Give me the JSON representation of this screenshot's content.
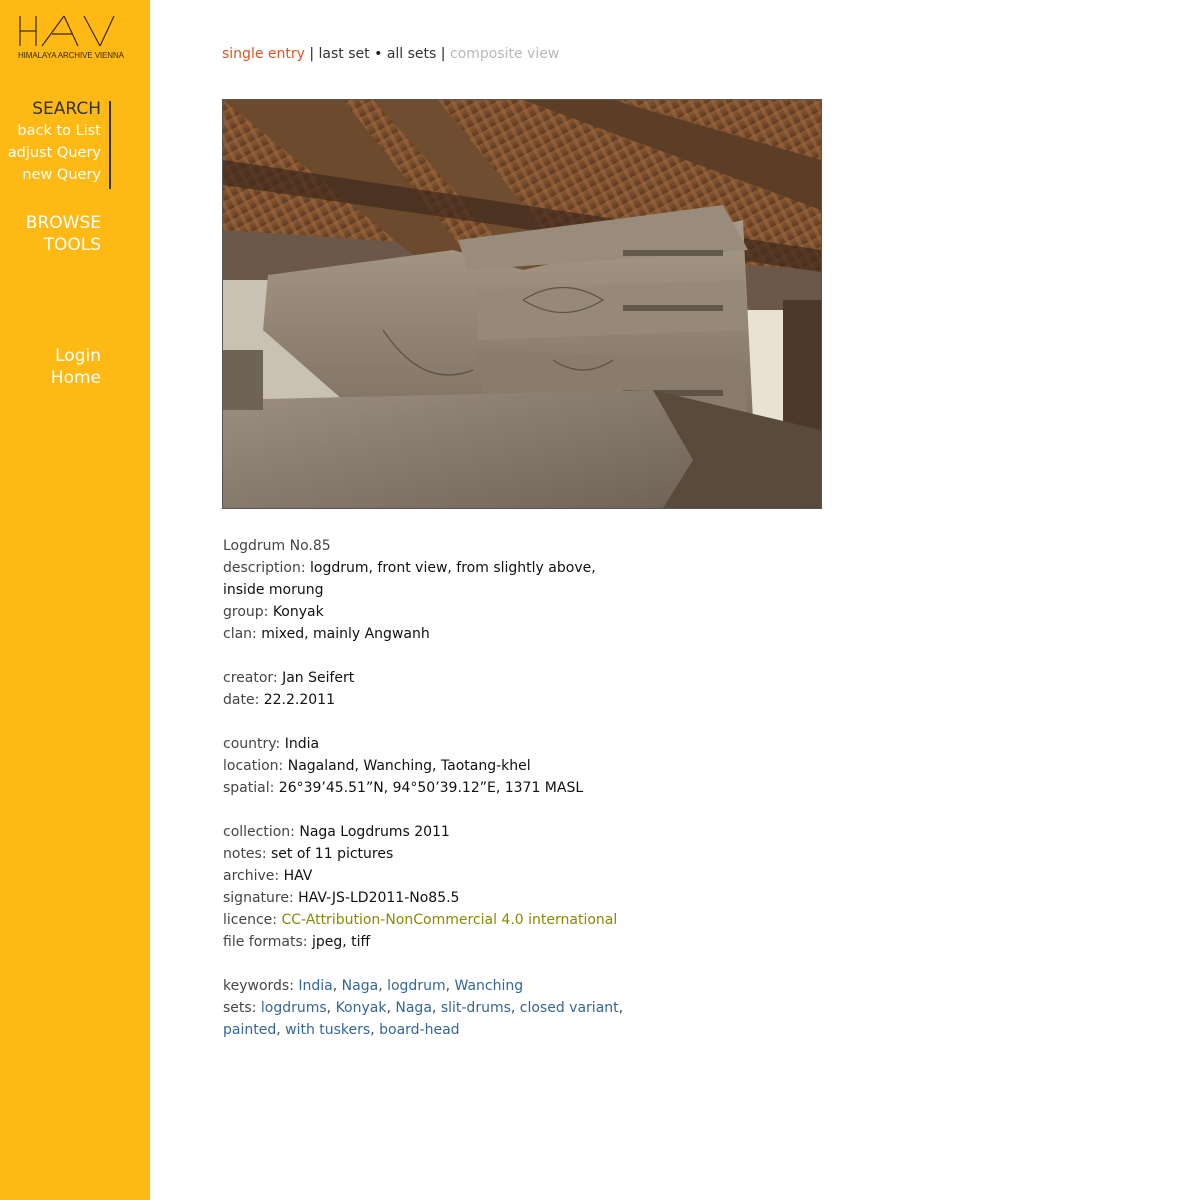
{
  "sidebar": {
    "logo_text": "HAV",
    "logo_subtitle": "HIMALAYA ARCHIVE VIENNA",
    "search_title": "SEARCH",
    "search_links": [
      "back to List",
      "adjust Query",
      "new Query"
    ],
    "browse": "BROWSE",
    "tools": "TOOLS",
    "login": "Login",
    "home": "Home"
  },
  "topnav": {
    "single_entry": "single entry",
    "sep1": " | ",
    "last_set": "last set",
    "bullet": " • ",
    "all_sets": "all sets",
    "sep2": " | ",
    "composite_view": "composite view"
  },
  "entry": {
    "title": "Logdrum No.85",
    "description_label": "description: ",
    "description_line1": "logdrum, front view, from slightly above,",
    "description_line2": "inside morung",
    "group_label": "group: ",
    "group": "Konyak",
    "clan_label": "clan: ",
    "clan": "mixed, mainly Angwanh",
    "creator_label": "creator: ",
    "creator": "Jan Seifert",
    "date_label": "date: ",
    "date": "22.2.2011",
    "country_label": "country: ",
    "country": "India",
    "location_label": "location: ",
    "location": "Nagaland, Wanching, Taotang-khel",
    "spatial_label": "spatial: ",
    "spatial": "26°39’45.51”N, 94°50’39.12”E, 1371 MASL",
    "collection_label": "collection: ",
    "collection": "Naga Logdrums 2011",
    "notes_label": "notes: ",
    "notes": "set of 11 pictures",
    "archive_label": "archive: ",
    "archive": "HAV",
    "signature_label": "signature: ",
    "signature": "HAV-JS-LD2011-No85.5",
    "licence_label": "licence: ",
    "licence": "CC-Attribution-NonCommercial 4.0 international",
    "fileformats_label": "file formats: ",
    "fileformats": "jpeg, tiff",
    "keywords_label": "keywords: ",
    "keywords": [
      "India",
      "Naga",
      "logdrum",
      "Wanching"
    ],
    "sets_label": "sets: ",
    "sets": [
      "logdrums",
      "Konyak",
      "Naga",
      "slit-drums",
      "closed variant",
      "painted",
      "with tuskers",
      "board-head"
    ]
  },
  "colors": {
    "sidebar": "#FFB915",
    "active_link": "#E0541E",
    "keyword_link": "#336699",
    "licence_link": "#8A8A00"
  }
}
